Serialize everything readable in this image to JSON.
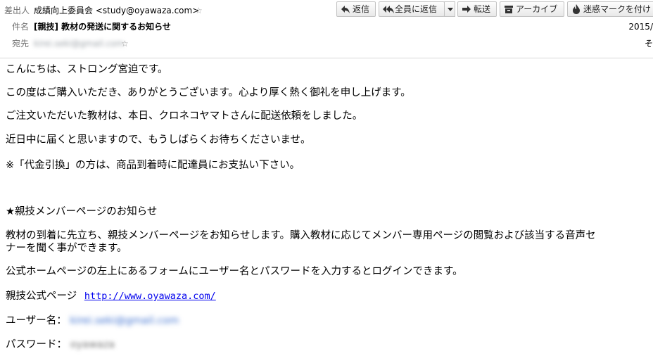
{
  "header": {
    "from_label": "差出人",
    "from_value": "成績向上委員会 <study@oyawaza.com>",
    "subject_label": "件名",
    "subject_value": "[親技] 教材の発送に関するお知らせ",
    "to_label": "宛先",
    "to_value": "kirei.seki@gmail.com",
    "date": "2015/",
    "other": "そ"
  },
  "toolbar": {
    "reply": "返信",
    "reply_all": "全員に返信",
    "forward": "転送",
    "archive": "アーカイブ",
    "junk": "迷惑マークを付け"
  },
  "body": {
    "greeting": "こんにちは、ストロング宮迫です。",
    "thanks": "この度はご購入いただき、ありがとうございます。心より厚く熱く御礼を申し上げます。",
    "shipping": "ご注文いただいた教材は、本日、クロネコヤマトさんに配送依頼をしました。",
    "arrival": "近日中に届くと思いますので、もうしばらくお待ちくださいませ。",
    "cod_note": "※「代金引換」の方は、商品到着時に配達員にお支払い下さい。",
    "section_title": "★親技メンバーページのお知らせ",
    "member_line1": "教材の到着に先立ち、親技メンバーページをお知らせします。購入教材に応じてメンバー専用ページの閲覧および該当する音声セ",
    "member_line2": "ナーを聞く事ができます。",
    "login_info": "公式ホームページの左上にあるフォームにユーザー名とパスワードを入力するとログインできます。",
    "site_label": "親技公式ページ",
    "site_url": "http://www.oyawaza.com/",
    "username_label": "ユーザー名：",
    "username_value": "kirei.seki@gmail.com",
    "password_label": "パスワード：",
    "password_value": "oyawaza"
  }
}
